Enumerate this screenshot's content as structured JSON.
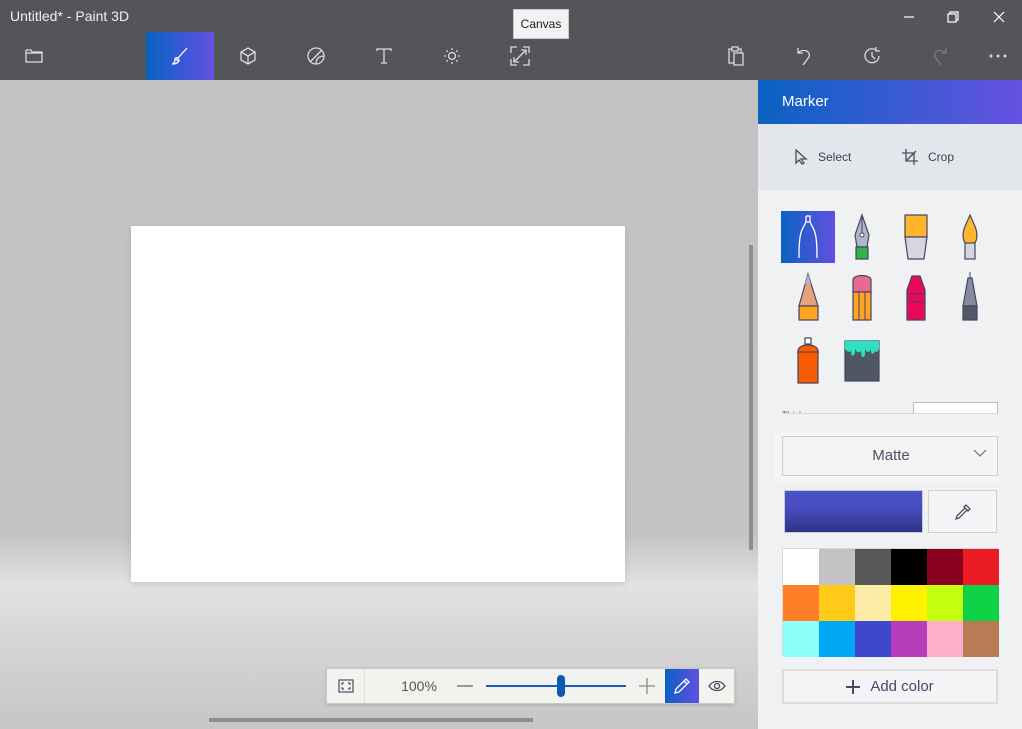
{
  "window": {
    "title": "Untitled* - Paint 3D",
    "controls": [
      "minimize",
      "restore",
      "close"
    ]
  },
  "toolbar": {
    "left": [
      {
        "name": "menu",
        "icon": "folder-icon",
        "active": false
      },
      {
        "name": "brushes",
        "icon": "brush-icon",
        "active": true
      },
      {
        "name": "3d-shapes",
        "icon": "cube-icon",
        "active": false
      },
      {
        "name": "stickers",
        "icon": "sticker-icon",
        "active": false
      },
      {
        "name": "text",
        "icon": "text-icon",
        "active": false
      },
      {
        "name": "effects",
        "icon": "sun-icon",
        "active": false
      },
      {
        "name": "canvas",
        "icon": "resize-icon",
        "active": false
      }
    ],
    "right": [
      {
        "name": "paste",
        "icon": "clipboard-icon",
        "enabled": true
      },
      {
        "name": "undo",
        "icon": "undo-icon",
        "enabled": true
      },
      {
        "name": "history",
        "icon": "history-icon",
        "enabled": true
      },
      {
        "name": "redo",
        "icon": "redo-icon",
        "enabled": false
      },
      {
        "name": "more",
        "icon": "more-icon",
        "enabled": true
      }
    ],
    "tooltip": "Canvas"
  },
  "panel": {
    "title": "Marker",
    "actions": [
      {
        "label": "Select",
        "icon": "cursor-icon"
      },
      {
        "label": "Crop",
        "icon": "crop-icon"
      }
    ],
    "brushes": [
      {
        "name": "marker",
        "active": true
      },
      {
        "name": "calligraphy-pen",
        "active": false
      },
      {
        "name": "oil-brush",
        "active": false
      },
      {
        "name": "watercolor",
        "active": false
      },
      {
        "name": "pencil",
        "active": false
      },
      {
        "name": "eraser",
        "active": false
      },
      {
        "name": "crayon",
        "active": false
      },
      {
        "name": "pixel-pen",
        "active": false
      },
      {
        "name": "spray-can",
        "active": false
      },
      {
        "name": "fill",
        "active": false
      }
    ],
    "thickness_label": "Thickness",
    "finish": "Matte",
    "current_color": "#4549b8",
    "palette": [
      "#ffffff",
      "#c3c3c3",
      "#585858",
      "#000000",
      "#88001b",
      "#ec1c24",
      "#ff7f27",
      "#ffca18",
      "#fdeca6",
      "#fff200",
      "#c4ff0e",
      "#0ed145",
      "#8cfffb",
      "#00a8f3",
      "#3f48cc",
      "#b83dba",
      "#ffaec8",
      "#b97a56"
    ],
    "add_color_label": "Add color"
  },
  "zoombar": {
    "zoom_label": "100%",
    "zoom_fraction": 0.5,
    "view_mode": "edit"
  },
  "colors": {
    "accent_start": "#0563c1",
    "accent_end": "#6752e0",
    "titlebar": "#54555a"
  }
}
